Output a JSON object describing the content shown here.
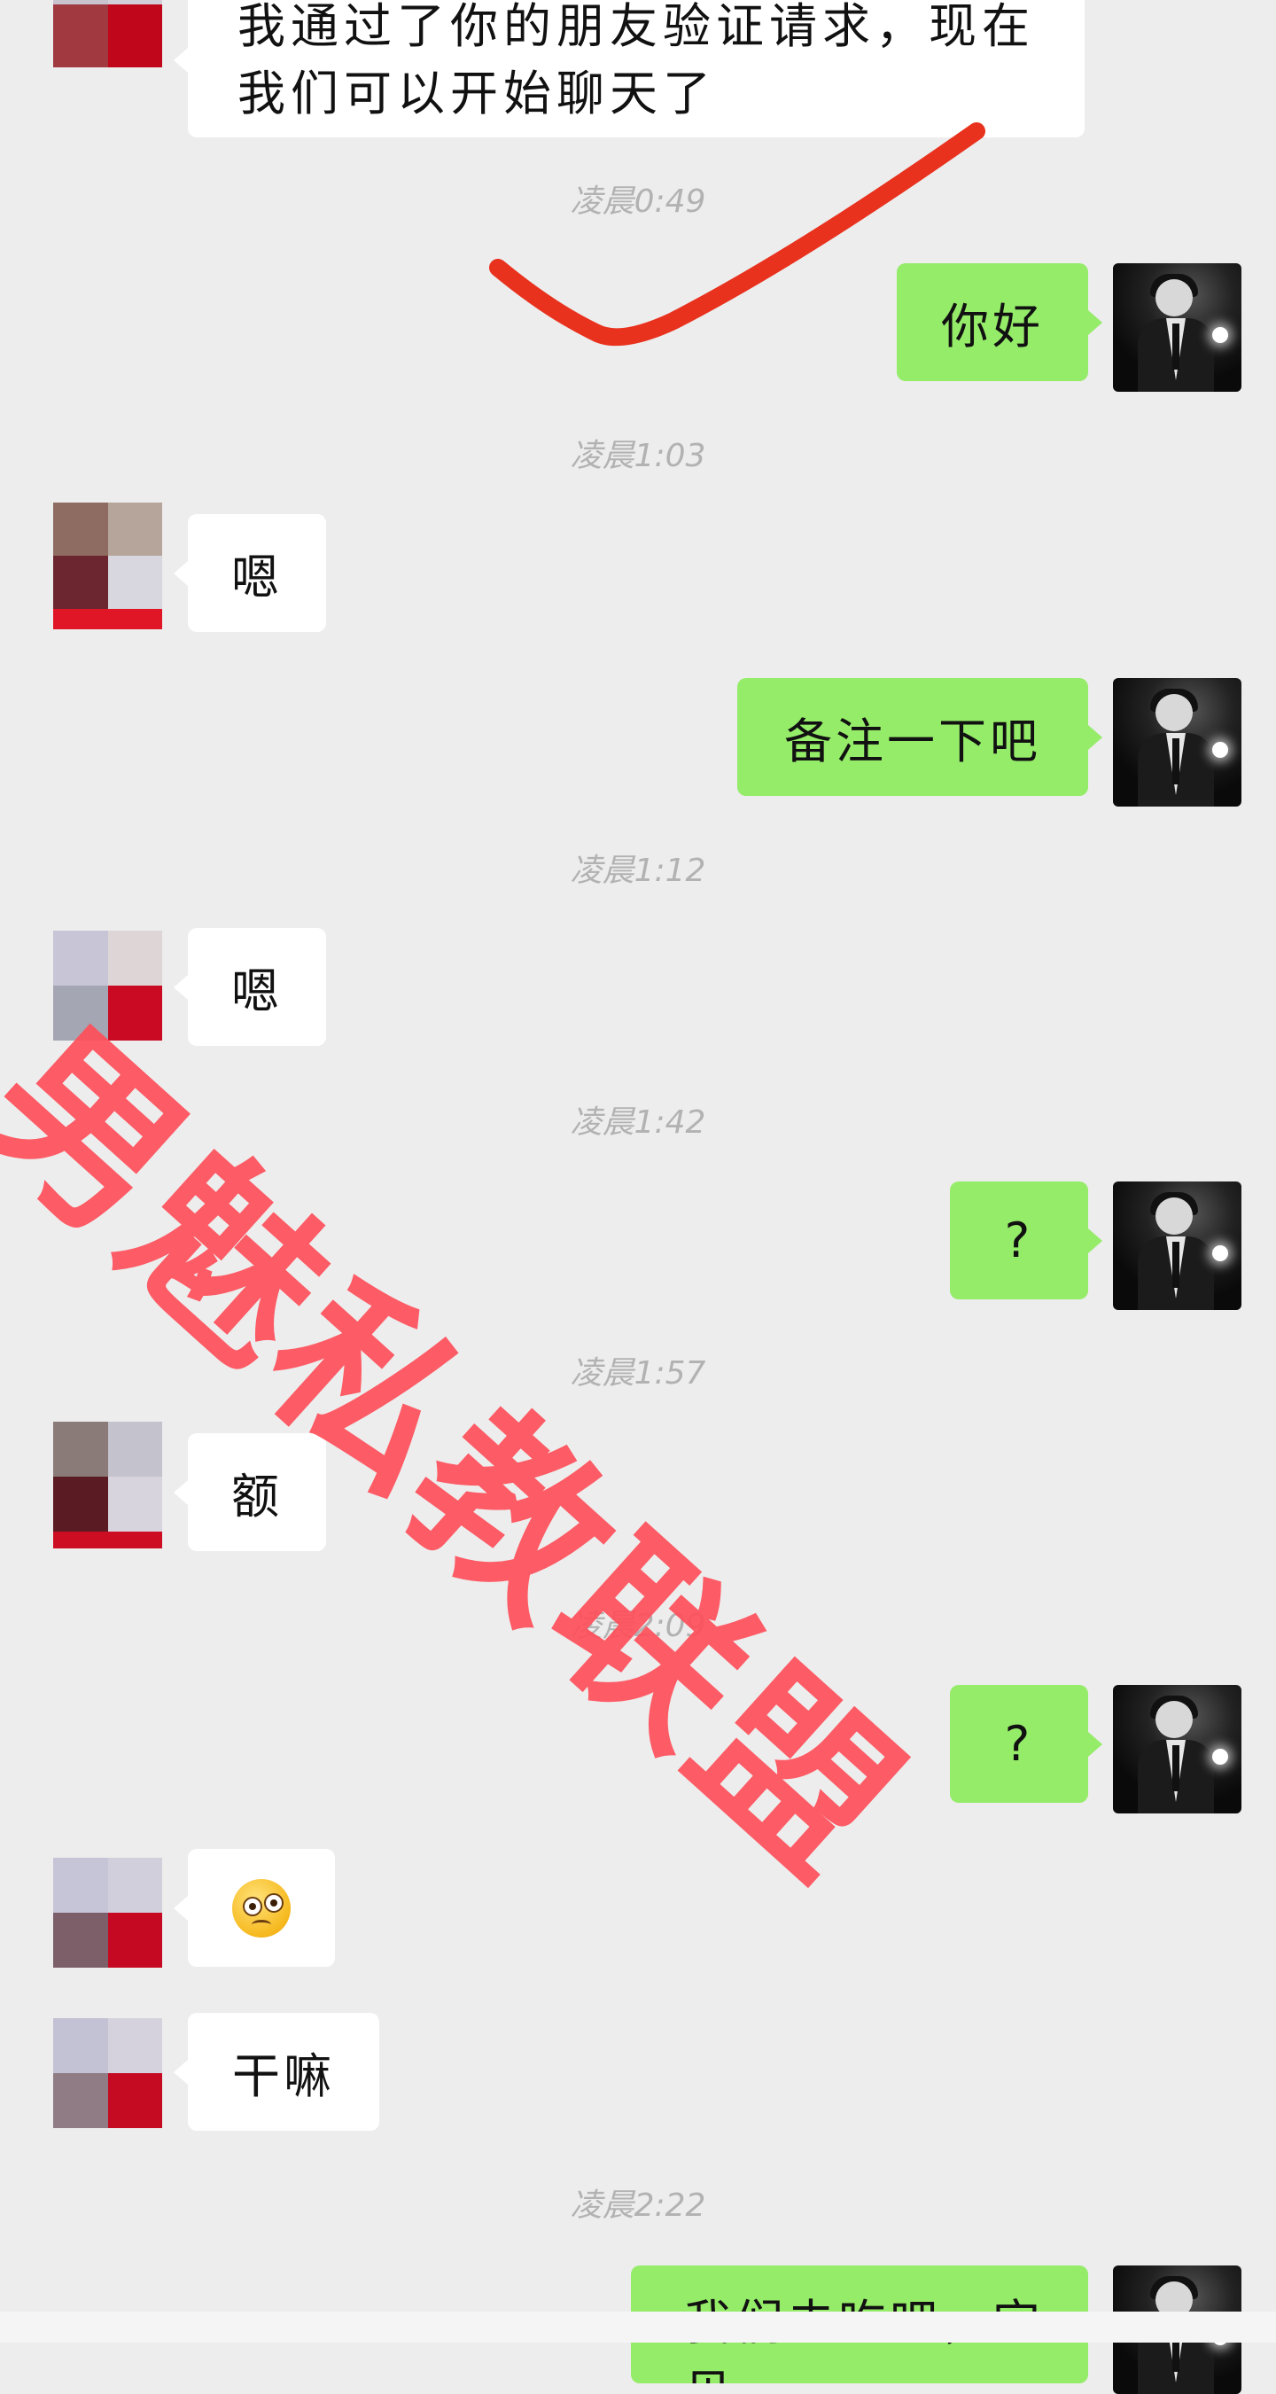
{
  "messages": {
    "m1": "我通过了你的朋友验证请求，现在我们可以开始聊天了",
    "m2": "你好",
    "m3": "嗯",
    "m4": "备注一下吧",
    "m5": "嗯",
    "m6": "?",
    "m7": "额",
    "m8": "?",
    "m9_emoji": "woozy-face-emoji",
    "m10": "干嘛",
    "m11_partial": "我们去吃吧，宝贝"
  },
  "timestamps": {
    "t1": "凌晨0:49",
    "t2": "凌晨1:03",
    "t3": "凌晨1:12",
    "t4": "凌晨1:42",
    "t5": "凌晨1:57",
    "t6": "凌晨2:09",
    "t7": "凌晨2:22"
  },
  "watermark": "男魅私教联盟",
  "colors": {
    "background": "#ededed",
    "outgoing_bubble": "#95ec69",
    "incoming_bubble": "#ffffff",
    "watermark": "#ff4f5a",
    "annotation": "#e8321e"
  }
}
